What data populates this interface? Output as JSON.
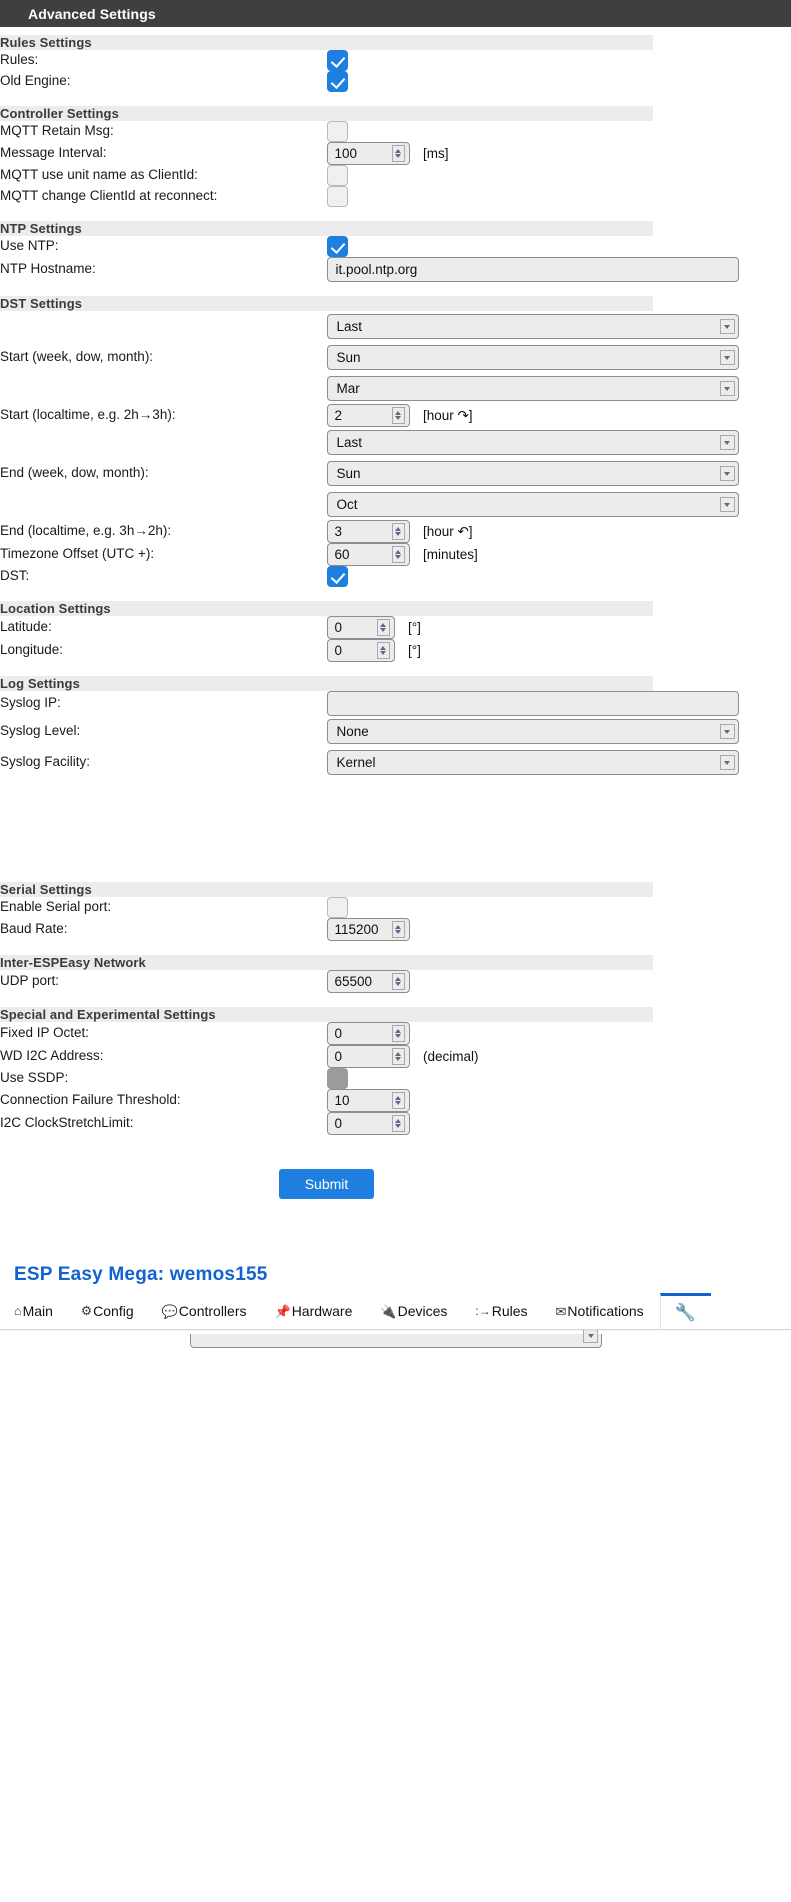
{
  "titlebar": {
    "title": "Advanced Settings"
  },
  "nav": {
    "brand": "ESP Easy Mega: wemos155",
    "items": [
      {
        "label": "Main",
        "icon": "home-icon",
        "glyph": "⌂"
      },
      {
        "label": "Config",
        "icon": "gear-icon",
        "glyph": "⚙"
      },
      {
        "label": "Controllers",
        "icon": "speech-bubble-icon",
        "glyph": "💬"
      },
      {
        "label": "Hardware",
        "icon": "pin-icon",
        "glyph": "📌"
      },
      {
        "label": "Devices",
        "icon": "plug-icon",
        "glyph": "🔌"
      },
      {
        "label": "Rules",
        "icon": "rules-icon",
        "glyph": ":→"
      },
      {
        "label": "Notifications",
        "icon": "mail-icon",
        "glyph": "✉"
      },
      {
        "label": "",
        "icon": "wrench-icon",
        "glyph": "🔧"
      }
    ]
  },
  "sections": {
    "rules": {
      "header": "Rules Settings"
    },
    "controller": {
      "header": "Controller Settings"
    },
    "ntp": {
      "header": "NTP Settings"
    },
    "dst": {
      "header": "DST Settings"
    },
    "location": {
      "header": "Location Settings"
    },
    "log": {
      "header": "Log Settings"
    },
    "serial": {
      "header": "Serial Settings"
    },
    "inter": {
      "header": "Inter-ESPEasy Network"
    },
    "special": {
      "header": "Special and Experimental Settings"
    }
  },
  "fields": {
    "rules": {
      "label": "Rules:",
      "checked": true
    },
    "old_engine": {
      "label": "Old Engine:",
      "checked": true
    },
    "mqtt_retain": {
      "label": "MQTT Retain Msg:",
      "checked": false
    },
    "message_interval": {
      "label": "Message Interval:",
      "value": "100",
      "unit": "[ms]"
    },
    "mqtt_unitname": {
      "label": "MQTT use unit name as ClientId:",
      "checked": false
    },
    "mqtt_change_id": {
      "label": "MQTT change ClientId at reconnect:",
      "checked": false
    },
    "use_ntp": {
      "label": "Use NTP:",
      "checked": true
    },
    "ntp_hostname": {
      "label": "NTP Hostname:",
      "value": "it.pool.ntp.org"
    },
    "dst_start": {
      "label": "Start (week, dow, month):",
      "week": "Last",
      "dow": "Sun",
      "month": "Mar"
    },
    "dst_start_time": {
      "label": "Start (localtime, e.g. 2h→3h):",
      "value": "2",
      "unit": "[hour ↷]"
    },
    "dst_end": {
      "label": "End (week, dow, month):",
      "week": "Last",
      "dow": "Sun",
      "month": "Oct"
    },
    "dst_end_time": {
      "label": "End (localtime, e.g. 3h→2h):",
      "value": "3",
      "unit": "[hour ↶]"
    },
    "tz_offset": {
      "label": "Timezone Offset (UTC +):",
      "value": "60",
      "unit": "[minutes]"
    },
    "dst": {
      "label": "DST:",
      "checked": true
    },
    "latitude": {
      "label": "Latitude:",
      "value": "0",
      "unit": "[°]"
    },
    "longitude": {
      "label": "Longitude:",
      "value": "0",
      "unit": "[°]"
    },
    "syslog_ip": {
      "label": "Syslog IP:",
      "value": ""
    },
    "syslog_level": {
      "label": "Syslog Level:",
      "value": "None"
    },
    "syslog_facility": {
      "label": "Syslog Facility:",
      "value": "Kernel"
    },
    "enable_serial": {
      "label": "Enable Serial port:",
      "checked": false
    },
    "baud_rate": {
      "label": "Baud Rate:",
      "value": "115200"
    },
    "udp_port": {
      "label": "UDP port:",
      "value": "65500"
    },
    "fixed_ip_octet": {
      "label": "Fixed IP Octet:",
      "value": "0"
    },
    "wd_i2c_address": {
      "label": "WD I2C Address:",
      "value": "0",
      "unit": "(decimal)"
    },
    "use_ssdp": {
      "label": "Use SSDP:",
      "checked": false
    },
    "conn_fail_thresh": {
      "label": "Connection Failure Threshold:",
      "value": "10"
    },
    "i2c_clockstretch": {
      "label": "I2C ClockStretchLimit:",
      "value": "0"
    }
  },
  "submit": {
    "label": "Submit"
  },
  "colors": {
    "accent": "#1f7fe0",
    "brand": "#1163cf",
    "titlebar": "#3f3f3f",
    "section": "#ececec"
  }
}
